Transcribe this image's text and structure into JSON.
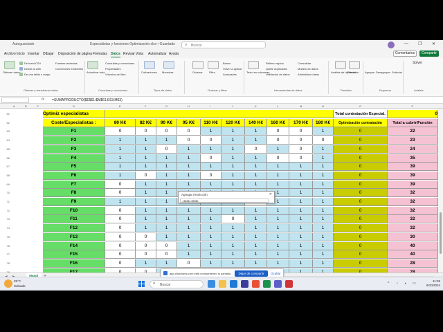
{
  "titlebar": {
    "autosave": "Autoguardado",
    "doc_title": "Especialistas y funciones Optimización.xlsx • Guardado",
    "search_placeholder": "Buscar",
    "comments": "Comentarios",
    "share": "Compartir"
  },
  "menu": [
    "Archivo",
    "Inicio",
    "Insertar",
    "Dibujar",
    "Disposición de página",
    "Fórmulas",
    "Datos",
    "Revisar",
    "Vista",
    "Automatizar",
    "Ayuda"
  ],
  "menu_active": "Datos",
  "ribbon": {
    "buttons": {
      "obtener_datos": "Obtener datos",
      "texto_csv": "De texto/CSV",
      "desde_web": "Desde la web",
      "tabla_rango": "De una tabla o rango",
      "fuentes_recientes": "Fuentes recientes",
      "conexiones": "Conexiones existentes",
      "actualizar": "Actualizar todo",
      "consultas": "Consultas y conexiones",
      "propiedades": "Propiedades",
      "vinculos": "Vínculos de libro",
      "cotizaciones": "Cotizaciones",
      "monedas": "Monedas",
      "ordenar": "Ordenar",
      "filtro": "Filtro",
      "borrar": "Borrar",
      "volver_aplicar": "Volver a aplicar",
      "avanzadas": "Avanzadas",
      "texto_columnas": "Texto en columnas",
      "relleno_rapido": "Relleno rápido",
      "quitar_duplicados": "Quitar duplicados",
      "validacion": "Validación de datos",
      "consolidar": "Consolidar",
      "modelo_datos": "Modelo de datos",
      "administrar": "Administrar datos",
      "analisis_hipotesis": "Análisis de hipótesis",
      "prevision": "Previsión",
      "agrupar": "Agrupar",
      "desagrupar": "Desagrupar",
      "subtotal": "Subtotal",
      "solver": "Solver"
    },
    "groups": {
      "obtener": "Obtener y transformar datos",
      "consultas": "Consultas y conexiones",
      "tipos": "Tipos de datos",
      "ordenar": "Ordenar y filtrar",
      "herramientas": "Herramientas de datos",
      "prevision": "Previsión",
      "esquema": "Esquema",
      "analisis": "Análisis"
    }
  },
  "formula_bar": {
    "fx": "fx",
    "formula": "=SUMAPRODUCTO($E$61:$M$61;E63:M63)"
  },
  "columns": [
    "A",
    "B",
    "C",
    "D",
    "E",
    "F",
    "G",
    "H",
    "I",
    "J",
    "K",
    "L",
    "M",
    "N",
    "O",
    "P"
  ],
  "sheet": {
    "title": "Optimiz especialistas",
    "header_label": "Coste/Especialistas :",
    "total_label": "Total contratación Especial.",
    "total_value": "0",
    "opt_header": "Optimización contratación",
    "cubrir_header": "Total a cubrir/Función",
    "costs": [
      "80 K€",
      "82 K€",
      "90 K€",
      "95 K€",
      "110 K€",
      "120 K€",
      "140 K€",
      "160 K€",
      "170 K€",
      "180 K€"
    ],
    "row_numbers": [
      "61",
      "62",
      "63",
      "64",
      "65",
      "66",
      "67",
      "68",
      "69",
      "70",
      "71",
      "72",
      "73",
      "74",
      "75",
      "76",
      "77",
      "78",
      "79",
      "80"
    ],
    "rows": [
      {
        "label": "F1",
        "v": [
          "0",
          "0",
          "0",
          "0",
          "1",
          "1",
          "1",
          "0",
          "0",
          "1"
        ],
        "opt": "0",
        "total": "22"
      },
      {
        "label": "F2",
        "v": [
          "1",
          "1",
          "1",
          "0",
          "0",
          "1",
          "1",
          "0",
          "0",
          "0"
        ],
        "opt": "0",
        "total": "23"
      },
      {
        "label": "F3",
        "v": [
          "1",
          "1",
          "0",
          "1",
          "1",
          "1",
          "0",
          "1",
          "0",
          "1"
        ],
        "opt": "0",
        "total": "24"
      },
      {
        "label": "F4",
        "v": [
          "1",
          "1",
          "1",
          "1",
          "0",
          "1",
          "1",
          "0",
          "0",
          "1"
        ],
        "opt": "0",
        "total": "35"
      },
      {
        "label": "F5",
        "v": [
          "1",
          "1",
          "1",
          "1",
          "1",
          "1",
          "1",
          "1",
          "1",
          "1"
        ],
        "opt": "0",
        "total": "39"
      },
      {
        "label": "F6",
        "v": [
          "1",
          "0",
          "1",
          "1",
          "0",
          "1",
          "1",
          "1",
          "1",
          "1"
        ],
        "opt": "0",
        "total": "39"
      },
      {
        "label": "F7",
        "v": [
          "0",
          "1",
          "1",
          "1",
          "1",
          "1",
          "1",
          "1",
          "1",
          "1"
        ],
        "opt": "0",
        "total": "39"
      },
      {
        "label": "F8",
        "v": [
          "0",
          "1",
          "1",
          "1",
          "1",
          "1",
          "1",
          "1",
          "1",
          "1"
        ],
        "opt": "0",
        "total": "32"
      },
      {
        "label": "F9",
        "v": [
          "1",
          "1",
          "1",
          "1",
          "1",
          "1",
          "0",
          "1",
          "1",
          "1"
        ],
        "opt": "0",
        "total": "32"
      },
      {
        "label": "F10",
        "v": [
          "0",
          "1",
          "1",
          "1",
          "1",
          "1",
          "1",
          "1",
          "1",
          "1"
        ],
        "opt": "0",
        "total": "32"
      },
      {
        "label": "F11",
        "v": [
          "0",
          "1",
          "1",
          "1",
          "1",
          "0",
          "1",
          "1",
          "1",
          "1"
        ],
        "opt": "0",
        "total": "32"
      },
      {
        "label": "F12",
        "v": [
          "0",
          "1",
          "1",
          "1",
          "1",
          "1",
          "1",
          "1",
          "1",
          "1"
        ],
        "opt": "0",
        "total": "32"
      },
      {
        "label": "F13",
        "v": [
          "0",
          "0",
          "1",
          "1",
          "1",
          "1",
          "1",
          "1",
          "1",
          "1"
        ],
        "opt": "0",
        "total": "30"
      },
      {
        "label": "F14",
        "v": [
          "0",
          "0",
          "0",
          "1",
          "1",
          "1",
          "1",
          "1",
          "1",
          "1"
        ],
        "opt": "0",
        "total": "40"
      },
      {
        "label": "F15",
        "v": [
          "0",
          "0",
          "0",
          "1",
          "1",
          "1",
          "1",
          "1",
          "1",
          "1"
        ],
        "opt": "0",
        "total": "40"
      },
      {
        "label": "F16",
        "v": [
          "0",
          "1",
          "1",
          "0",
          "1",
          "1",
          "1",
          "1",
          "1",
          "1"
        ],
        "opt": "0",
        "total": "28"
      },
      {
        "label": "F17",
        "v": [
          "0",
          "0",
          "1",
          "1",
          "1",
          "1",
          "1",
          "1",
          "1",
          "1"
        ],
        "opt": "0",
        "total": "28"
      }
    ]
  },
  "popup": {
    "title": "Agregar restricción",
    "value": "=$M$4:$M$5"
  },
  "sheet_tab": "Hoja1",
  "share_notice": {
    "message": "app.clipchamp.com está compartiendo tu pantalla.",
    "stop": "Dejar de compartir",
    "hide": "Ocultar"
  },
  "status": {
    "ready": "Listo",
    "accessibility": "Accesibilidad: todo correcto",
    "zoom": "100 %"
  },
  "taskbar": {
    "temp": "25°C",
    "weather": "Soleado",
    "search": "Buscar",
    "time": "11:28",
    "date": "6/10/2024"
  },
  "colors": {
    "green_cells": "#66dd66",
    "yellow_cells": "#ffff00",
    "lightblue_cells": "#bfe3ef",
    "olive_cells": "#c8cc00",
    "pink_cells": "#f4c2d3",
    "excel_green": "#117a3b"
  }
}
